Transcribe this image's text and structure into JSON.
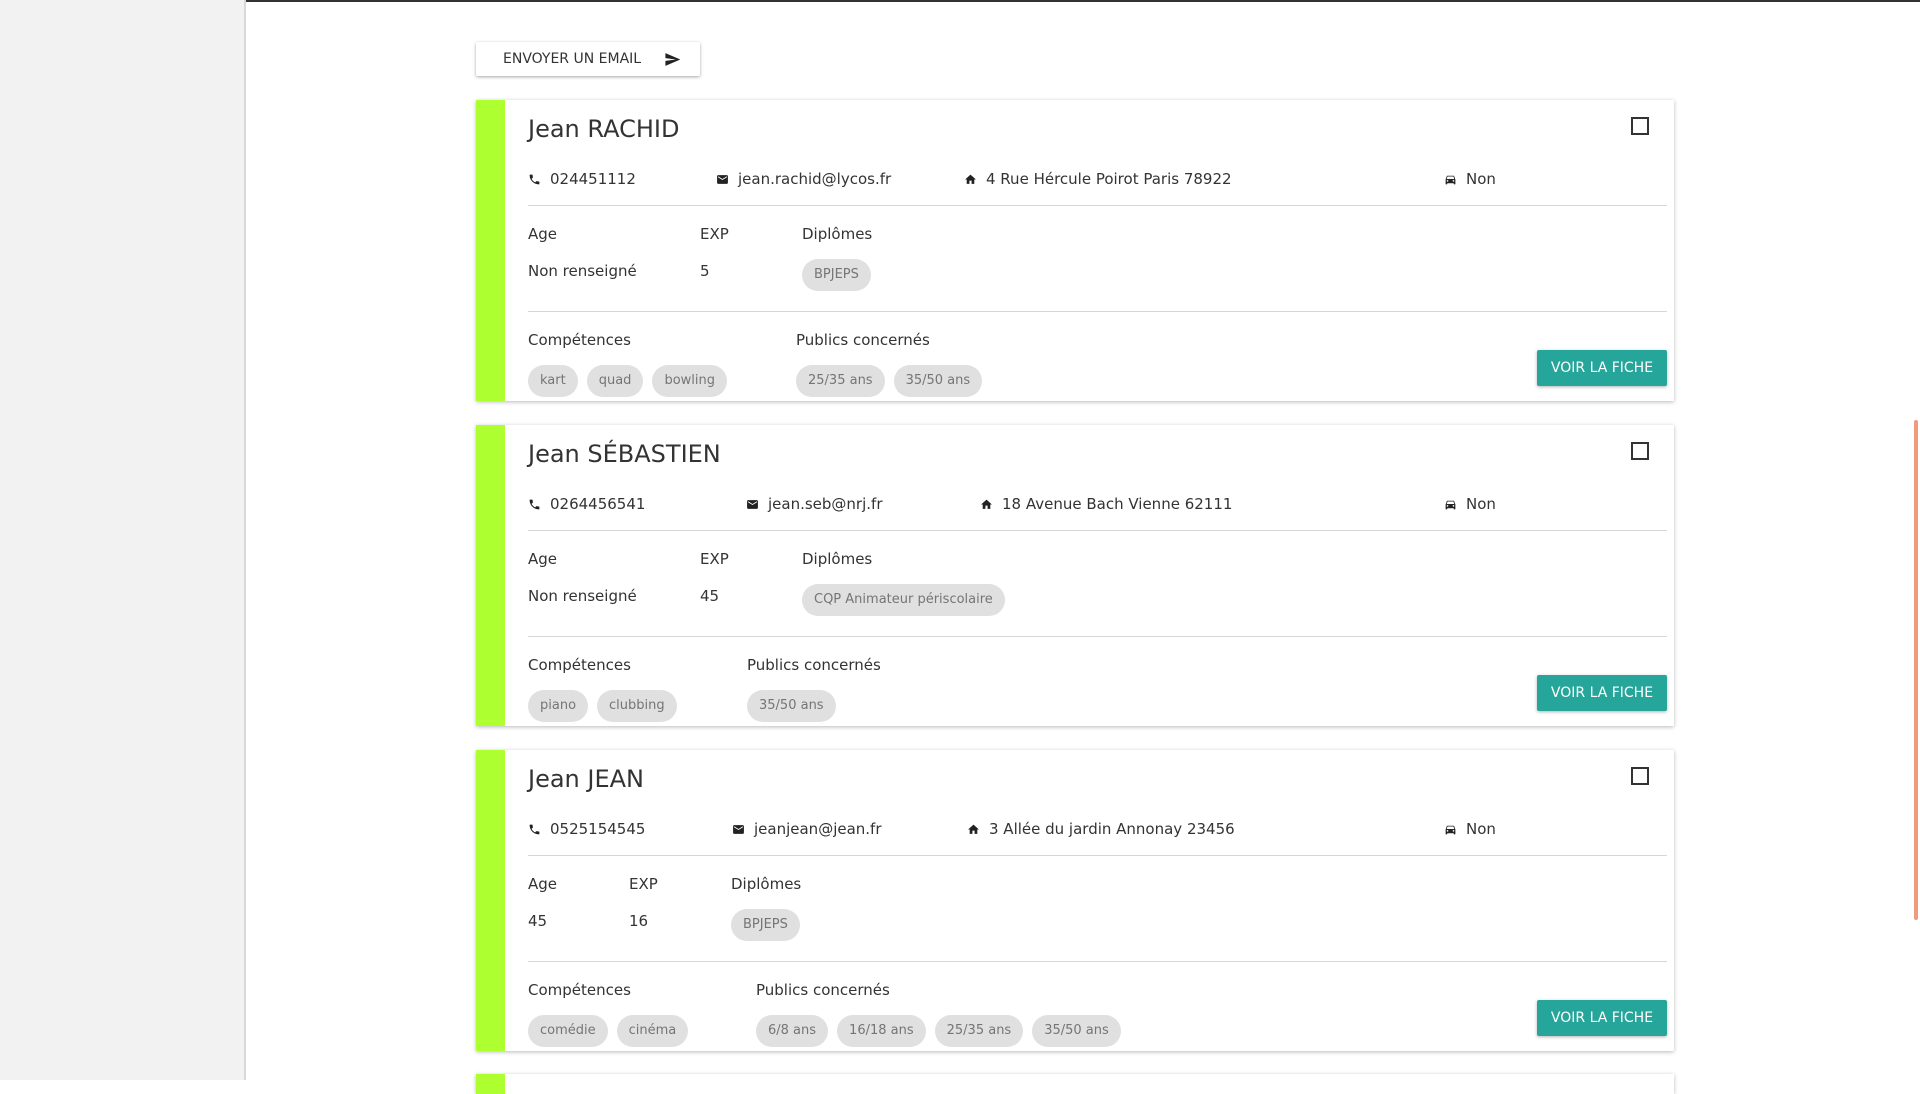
{
  "toolbar": {
    "email_label": "ENVOYER UN EMAIL",
    "email_icon": "send-icon"
  },
  "labels": {
    "age": "Age",
    "exp": "EXP",
    "diplomes": "Diplômes",
    "competences": "Compétences",
    "publics": "Publics concernés",
    "view_button": "VOIR LA FICHE"
  },
  "colors": {
    "accent_stripe": "#adff2f",
    "button": "#26a69a",
    "chip": "#e0e0e0"
  },
  "candidates": [
    {
      "name": "Jean RACHID",
      "phone": "024451112",
      "email": "jean.rachid@lycos.fr",
      "address": "4 Rue Hércule Poirot Paris 78922",
      "vehicle": "Non",
      "age": "Non renseigné",
      "exp": "5",
      "diplomes": [
        "BPJEPS"
      ],
      "competences": [
        "kart",
        "quad",
        "bowling"
      ],
      "publics": [
        "25/35 ans",
        "35/50 ans"
      ]
    },
    {
      "name": "Jean SÉBASTIEN",
      "phone": "0264456541",
      "email": "jean.seb@nrj.fr",
      "address": "18 Avenue Bach Vienne 62111",
      "vehicle": "Non",
      "age": "Non renseigné",
      "exp": "45",
      "diplomes": [
        "CQP Animateur périscolaire"
      ],
      "competences": [
        "piano",
        "clubbing"
      ],
      "publics": [
        "35/50 ans"
      ]
    },
    {
      "name": "Jean JEAN",
      "phone": "0525154545",
      "email": "jeanjean@jean.fr",
      "address": "3 Allée du jardin Annonay 23456",
      "vehicle": "Non",
      "age": "45",
      "exp": "16",
      "diplomes": [
        "BPJEPS"
      ],
      "competences": [
        "comédie",
        "cinéma"
      ],
      "publics": [
        "6/8 ans",
        "16/18 ans",
        "25/35 ans",
        "35/50 ans"
      ]
    }
  ]
}
